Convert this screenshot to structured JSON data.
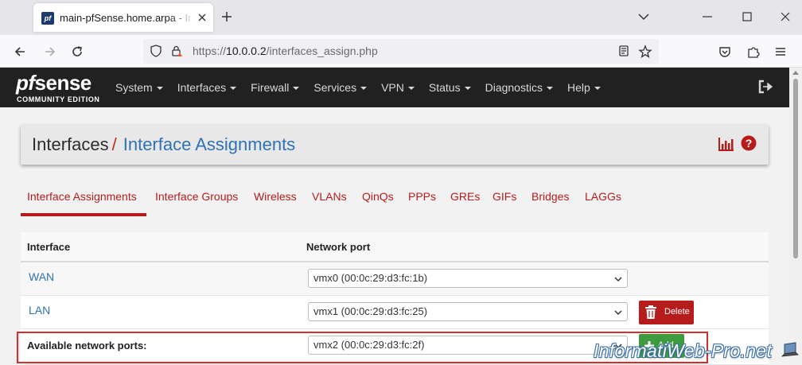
{
  "browser": {
    "tab_title": "main-pfSense.home.arpa - Interfaces",
    "url_prefix": "https://",
    "url_host": "10.0.0.2",
    "url_path": "/interfaces_assign.php",
    "favicon_text": "pf"
  },
  "pfsense": {
    "logo_main_pf": "pf",
    "logo_main_sense": "sense",
    "logo_sub": "COMMUNITY EDITION",
    "menu": [
      {
        "label": "System"
      },
      {
        "label": "Interfaces"
      },
      {
        "label": "Firewall"
      },
      {
        "label": "Services"
      },
      {
        "label": "VPN"
      },
      {
        "label": "Status"
      },
      {
        "label": "Diagnostics"
      },
      {
        "label": "Help"
      }
    ]
  },
  "breadcrumb": {
    "parent": "Interfaces",
    "separator": "/",
    "current": "Interface Assignments"
  },
  "tabs": [
    {
      "label": "Interface Assignments",
      "active": true
    },
    {
      "label": "Interface Groups"
    },
    {
      "label": "Wireless"
    },
    {
      "label": "VLANs"
    },
    {
      "label": "QinQs"
    },
    {
      "label": "PPPs"
    },
    {
      "label": "GREs"
    },
    {
      "label": "GIFs"
    },
    {
      "label": "Bridges"
    },
    {
      "label": "LAGGs"
    }
  ],
  "table": {
    "headers": {
      "interface": "Interface",
      "network_port": "Network port"
    },
    "rows": [
      {
        "interface": "WAN",
        "port": "vmx0 (00:0c:29:d3:fc:1b)"
      },
      {
        "interface": "LAN",
        "port": "vmx1 (00:0c:29:d3:fc:25)",
        "action": "Delete"
      }
    ],
    "available": {
      "label": "Available network ports:",
      "port": "vmx2 (00:0c:29:d3:fc:2f)",
      "action": "Add"
    }
  },
  "watermark": "InformatiWeb-Pro.net",
  "colors": {
    "brand_red": "#b71c1c",
    "link_blue": "#2f72b5",
    "header_dark": "#212121",
    "add_green": "#3e9a3e",
    "highlight": "#d32f2f"
  }
}
